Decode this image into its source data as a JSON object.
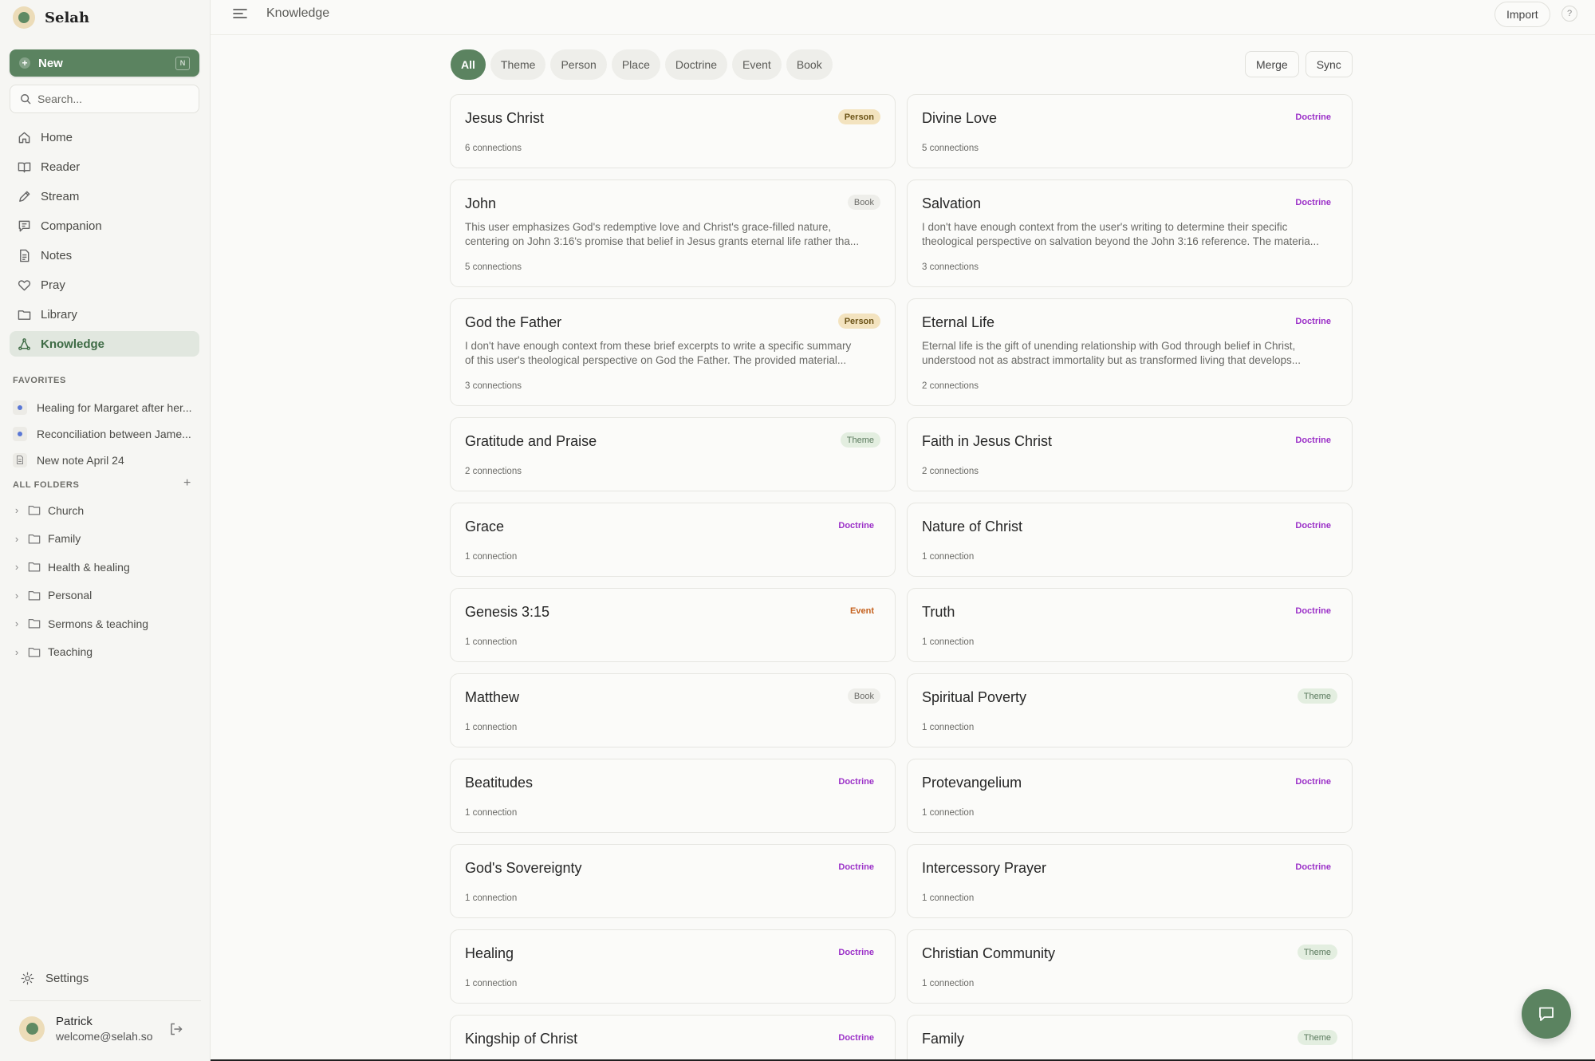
{
  "app": {
    "name": "Selah"
  },
  "sidebar": {
    "new_label": "New",
    "new_shortcut": "N",
    "search_placeholder": "Search...",
    "nav": [
      {
        "label": "Home",
        "icon": "home-icon"
      },
      {
        "label": "Reader",
        "icon": "book-icon"
      },
      {
        "label": "Stream",
        "icon": "pen-icon"
      },
      {
        "label": "Companion",
        "icon": "chat-icon"
      },
      {
        "label": "Notes",
        "icon": "document-icon"
      },
      {
        "label": "Pray",
        "icon": "heart-icon"
      },
      {
        "label": "Library",
        "icon": "folder-icon"
      },
      {
        "label": "Knowledge",
        "icon": "graph-icon",
        "active": true
      }
    ],
    "favorites_label": "FAVORITES",
    "favorites": [
      {
        "label": "Healing for Margaret after her..."
      },
      {
        "label": "Reconciliation between Jame..."
      },
      {
        "label": "New note April 24"
      }
    ],
    "folders_label": "ALL FOLDERS",
    "add_folder": "+",
    "folders": [
      {
        "label": "Church"
      },
      {
        "label": "Family"
      },
      {
        "label": "Health & healing"
      },
      {
        "label": "Personal"
      },
      {
        "label": "Sermons & teaching"
      },
      {
        "label": "Teaching"
      }
    ],
    "settings_label": "Settings",
    "user": {
      "name": "Patrick",
      "email": "welcome@selah.so"
    }
  },
  "topbar": {
    "title": "Knowledge",
    "import_label": "Import",
    "help_label": "?"
  },
  "filters": {
    "chips": [
      {
        "label": "All",
        "active": true
      },
      {
        "label": "Theme"
      },
      {
        "label": "Person"
      },
      {
        "label": "Place"
      },
      {
        "label": "Doctrine"
      },
      {
        "label": "Event"
      },
      {
        "label": "Book"
      }
    ],
    "merge_label": "Merge",
    "sync_label": "Sync"
  },
  "cards": [
    {
      "title": "Jesus Christ",
      "type": "Person",
      "meta": "6 connections"
    },
    {
      "title": "Divine Love",
      "type": "Doctrine",
      "meta": "5 connections"
    },
    {
      "title": "John",
      "type": "Book",
      "meta": "5 connections",
      "desc1": "This user emphasizes God's redemptive love and Christ's grace-filled nature,",
      "desc2": "centering on John 3:16's promise that belief in Jesus grants eternal life rather tha..."
    },
    {
      "title": "Salvation",
      "type": "Doctrine",
      "meta": "3 connections",
      "desc1": "I don't have enough context from the user's writing to determine their specific",
      "desc2": "theological perspective on salvation beyond the John 3:16 reference. The materia..."
    },
    {
      "title": "God the Father",
      "type": "Person",
      "meta": "3 connections",
      "desc1": "I don't have enough context from these brief excerpts to write a specific summary",
      "desc2": "of this user's theological perspective on God the Father. The provided material..."
    },
    {
      "title": "Eternal Life",
      "type": "Doctrine",
      "meta": "2 connections",
      "desc1": "Eternal life is the gift of unending relationship with God through belief in Christ,",
      "desc2": "understood not as abstract immortality but as transformed living that develops..."
    },
    {
      "title": "Gratitude and Praise",
      "type": "Theme",
      "meta": "2 connections"
    },
    {
      "title": "Faith in Jesus Christ",
      "type": "Doctrine",
      "meta": "2 connections"
    },
    {
      "title": "Grace",
      "type": "Doctrine",
      "meta": "1 connection"
    },
    {
      "title": "Nature of Christ",
      "type": "Doctrine",
      "meta": "1 connection"
    },
    {
      "title": "Genesis 3:15",
      "type": "Event",
      "meta": "1 connection"
    },
    {
      "title": "Truth",
      "type": "Doctrine",
      "meta": "1 connection"
    },
    {
      "title": "Matthew",
      "type": "Book",
      "meta": "1 connection"
    },
    {
      "title": "Spiritual Poverty",
      "type": "Theme",
      "meta": "1 connection"
    },
    {
      "title": "Beatitudes",
      "type": "Doctrine",
      "meta": "1 connection"
    },
    {
      "title": "Protevangelium",
      "type": "Doctrine",
      "meta": "1 connection"
    },
    {
      "title": "God's Sovereignty",
      "type": "Doctrine",
      "meta": "1 connection"
    },
    {
      "title": "Intercessory Prayer",
      "type": "Doctrine",
      "meta": "1 connection"
    },
    {
      "title": "Healing",
      "type": "Doctrine",
      "meta": "1 connection"
    },
    {
      "title": "Christian Community",
      "type": "Theme",
      "meta": "1 connection"
    },
    {
      "title": "Kingship of Christ",
      "type": "Doctrine",
      "meta": ""
    },
    {
      "title": "Family",
      "type": "Theme",
      "meta": ""
    }
  ],
  "colors": {
    "accent": "#5b8360",
    "doctrine": "#9b30c8",
    "event": "#c5611e",
    "person_bg": "#f3e3bf"
  }
}
